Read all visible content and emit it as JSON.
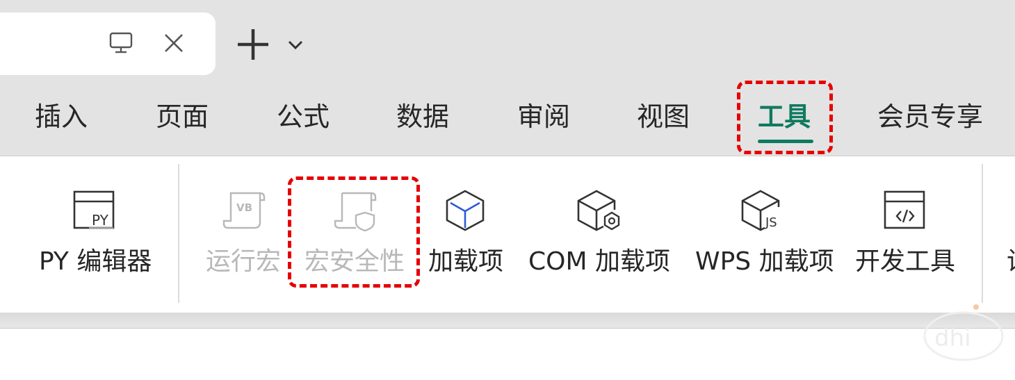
{
  "tabbar": {
    "icons": {
      "screen": "monitor-icon",
      "close": "close-icon",
      "new_tab": "plus-icon",
      "dropdown": "chevron-down-icon"
    }
  },
  "menu": {
    "tabs": [
      "插入",
      "页面",
      "公式",
      "数据",
      "审阅",
      "视图",
      "工具",
      "会员专享"
    ],
    "active": "工具"
  },
  "ribbon": {
    "tools": [
      {
        "label": "PY 编辑器",
        "icon": "py-editor-icon",
        "enabled": true
      },
      {
        "label": "运行宏",
        "icon": "vb-macro-icon",
        "enabled": false
      },
      {
        "label": "宏安全性",
        "icon": "macro-security-icon",
        "enabled": false
      },
      {
        "label": "加载项",
        "icon": "cube-icon",
        "enabled": true
      },
      {
        "label": "COM 加载项",
        "icon": "com-addin-icon",
        "enabled": true
      },
      {
        "label": "WPS 加载项",
        "icon": "js-addin-icon",
        "enabled": true
      },
      {
        "label": "开发工具",
        "icon": "dev-tools-icon",
        "enabled": true
      }
    ],
    "truncated_next": "设"
  },
  "colors": {
    "accent": "#0f7a60",
    "highlight": "#e60000",
    "disabled": "#b8b8b8",
    "cube_accent": "#2a5bd7"
  }
}
